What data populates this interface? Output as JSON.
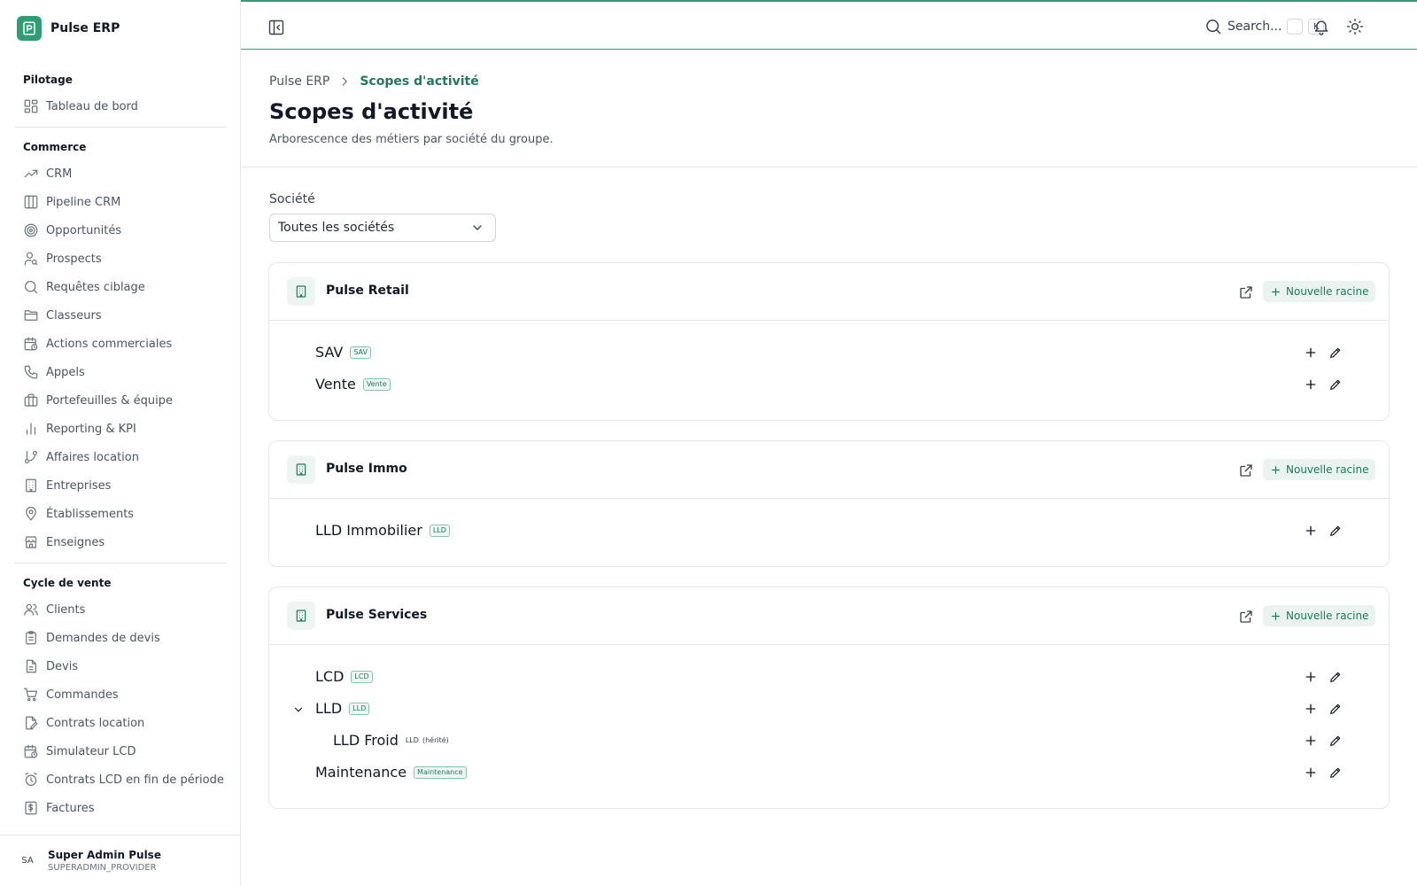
{
  "app": {
    "name": "Pulse ERP"
  },
  "sidebar": {
    "groups": [
      {
        "title": "Pilotage",
        "items": [
          {
            "label": "Tableau de bord",
            "icon": "dashboard-icon"
          }
        ]
      },
      {
        "title": "Commerce",
        "items": [
          {
            "label": "CRM",
            "icon": "trending-up-icon"
          },
          {
            "label": "Pipeline CRM",
            "icon": "columns-icon"
          },
          {
            "label": "Opportunités",
            "icon": "target-icon"
          },
          {
            "label": "Prospects",
            "icon": "user-search-icon"
          },
          {
            "label": "Requêtes ciblage",
            "icon": "search-icon"
          },
          {
            "label": "Classeurs",
            "icon": "folder-icon"
          },
          {
            "label": "Actions commerciales",
            "icon": "calendar-clock-icon"
          },
          {
            "label": "Appels",
            "icon": "phone-icon"
          },
          {
            "label": "Portefeuilles & équipe",
            "icon": "briefcase-icon"
          },
          {
            "label": "Reporting & KPI",
            "icon": "bar-chart-icon"
          },
          {
            "label": "Affaires location",
            "icon": "git-branch-icon"
          },
          {
            "label": "Entreprises",
            "icon": "building-icon"
          },
          {
            "label": "Établissements",
            "icon": "map-pin-icon"
          },
          {
            "label": "Enseignes",
            "icon": "store-icon"
          }
        ]
      },
      {
        "title": "Cycle de vente",
        "items": [
          {
            "label": "Clients",
            "icon": "users-icon"
          },
          {
            "label": "Demandes de devis",
            "icon": "clipboard-list-icon"
          },
          {
            "label": "Devis",
            "icon": "file-text-icon"
          },
          {
            "label": "Commandes",
            "icon": "cart-icon"
          },
          {
            "label": "Contrats location",
            "icon": "file-signature-icon"
          },
          {
            "label": "Simulateur LCD",
            "icon": "calendar-clock-icon"
          },
          {
            "label": "Contrats LCD en fin de période",
            "icon": "alarm-clock-icon"
          },
          {
            "label": "Factures",
            "icon": "invoice-icon"
          }
        ]
      }
    ]
  },
  "user": {
    "initials": "SA",
    "name": "Super Admin Pulse",
    "role": "SUPERADMIN_PROVIDER"
  },
  "topbar": {
    "search_label": "Search...",
    "shortcut_mod": "",
    "shortcut_key": "K"
  },
  "breadcrumb": {
    "root": "Pulse ERP",
    "current": "Scopes d'activité"
  },
  "page": {
    "title": "Scopes d'activité",
    "subtitle": "Arborescence des métiers par société du groupe."
  },
  "filter": {
    "label": "Société",
    "value": "Toutes les sociétés"
  },
  "new_root_label": "Nouvelle racine",
  "companies": [
    {
      "name": "Pulse Retail",
      "scopes": [
        {
          "label": "SAV",
          "code": "SAV"
        },
        {
          "label": "Vente",
          "code": "Vente"
        }
      ]
    },
    {
      "name": "Pulse Immo",
      "scopes": [
        {
          "label": "LLD Immobilier",
          "code": "LLD"
        }
      ]
    },
    {
      "name": "Pulse Services",
      "scopes": [
        {
          "label": "LCD",
          "code": "LCD"
        },
        {
          "label": "LLD",
          "code": "LLD",
          "expanded": true
        },
        {
          "label": "LLD Froid",
          "code": "LLD",
          "inherited": "(hérité)"
        },
        {
          "label": "Maintenance",
          "code": "Maintenance"
        }
      ]
    }
  ],
  "colors": {
    "accent": "#2f9e73",
    "accent_text": "#1f7a5c",
    "accent_bg": "#eaf3ef"
  }
}
